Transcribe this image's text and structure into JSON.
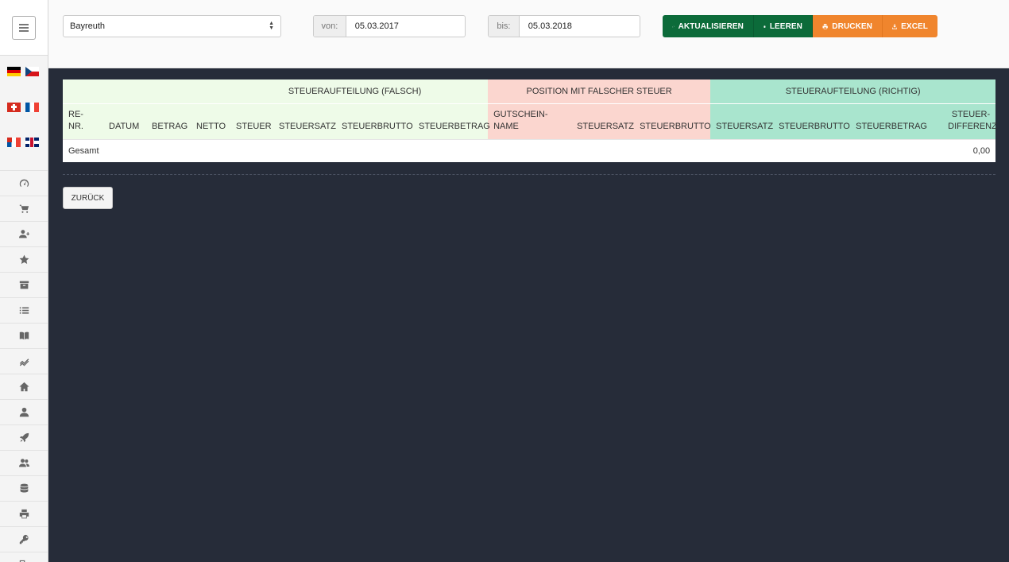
{
  "filters": {
    "location": "Bayreuth",
    "from_label": "von:",
    "from_value": "05.03.2017",
    "to_label": "bis:",
    "to_value": "05.03.2018"
  },
  "toolbar": {
    "refresh_label": "AKTUALISIEREN",
    "clear_label": "LEEREN",
    "print_label": "DRUCKEN",
    "excel_label": "EXCEL",
    "colors": {
      "green": "#0c6b3a",
      "orange": "#f0852d"
    }
  },
  "sidebar": {
    "languages": [
      "de",
      "cz",
      "ch",
      "fr",
      "fr-ca",
      "uk"
    ],
    "items": [
      {
        "icon": "dashboard-icon"
      },
      {
        "icon": "cart-icon"
      },
      {
        "icon": "add-user-icon"
      },
      {
        "icon": "star-icon"
      },
      {
        "icon": "archive-icon"
      },
      {
        "icon": "list-icon"
      },
      {
        "icon": "book-icon"
      },
      {
        "icon": "chart-icon"
      },
      {
        "icon": "home-icon"
      },
      {
        "icon": "user-icon"
      },
      {
        "icon": "rocket-icon"
      },
      {
        "icon": "users-icon"
      },
      {
        "icon": "database-icon"
      },
      {
        "icon": "print-icon"
      },
      {
        "icon": "key-icon"
      },
      {
        "icon": "logout-icon"
      }
    ]
  },
  "table": {
    "groups": {
      "falsch": "STEUERAUFTEILUNG (FALSCH)",
      "position": "POSITION MIT FALSCHER STEUER",
      "richtig": "STEUERAUFTEILUNG (RICHTIG)"
    },
    "columns": [
      "RE-NR.",
      "DATUM",
      "BETRAG",
      "NETTO",
      "STEUER",
      "STEUERSATZ",
      "STEUERBRUTTO",
      "STEUERBETRAG",
      "GUTSCHEIN-NAME",
      "STEUERSATZ",
      "STEUERBRUTTO",
      "STEUERSATZ",
      "STEUERBRUTTO",
      "STEUERBETRAG",
      "STEUER-DIFFERENZ"
    ],
    "total_label": "Gesamt",
    "total_value": "0,00"
  },
  "back_label": "ZURÜCK"
}
